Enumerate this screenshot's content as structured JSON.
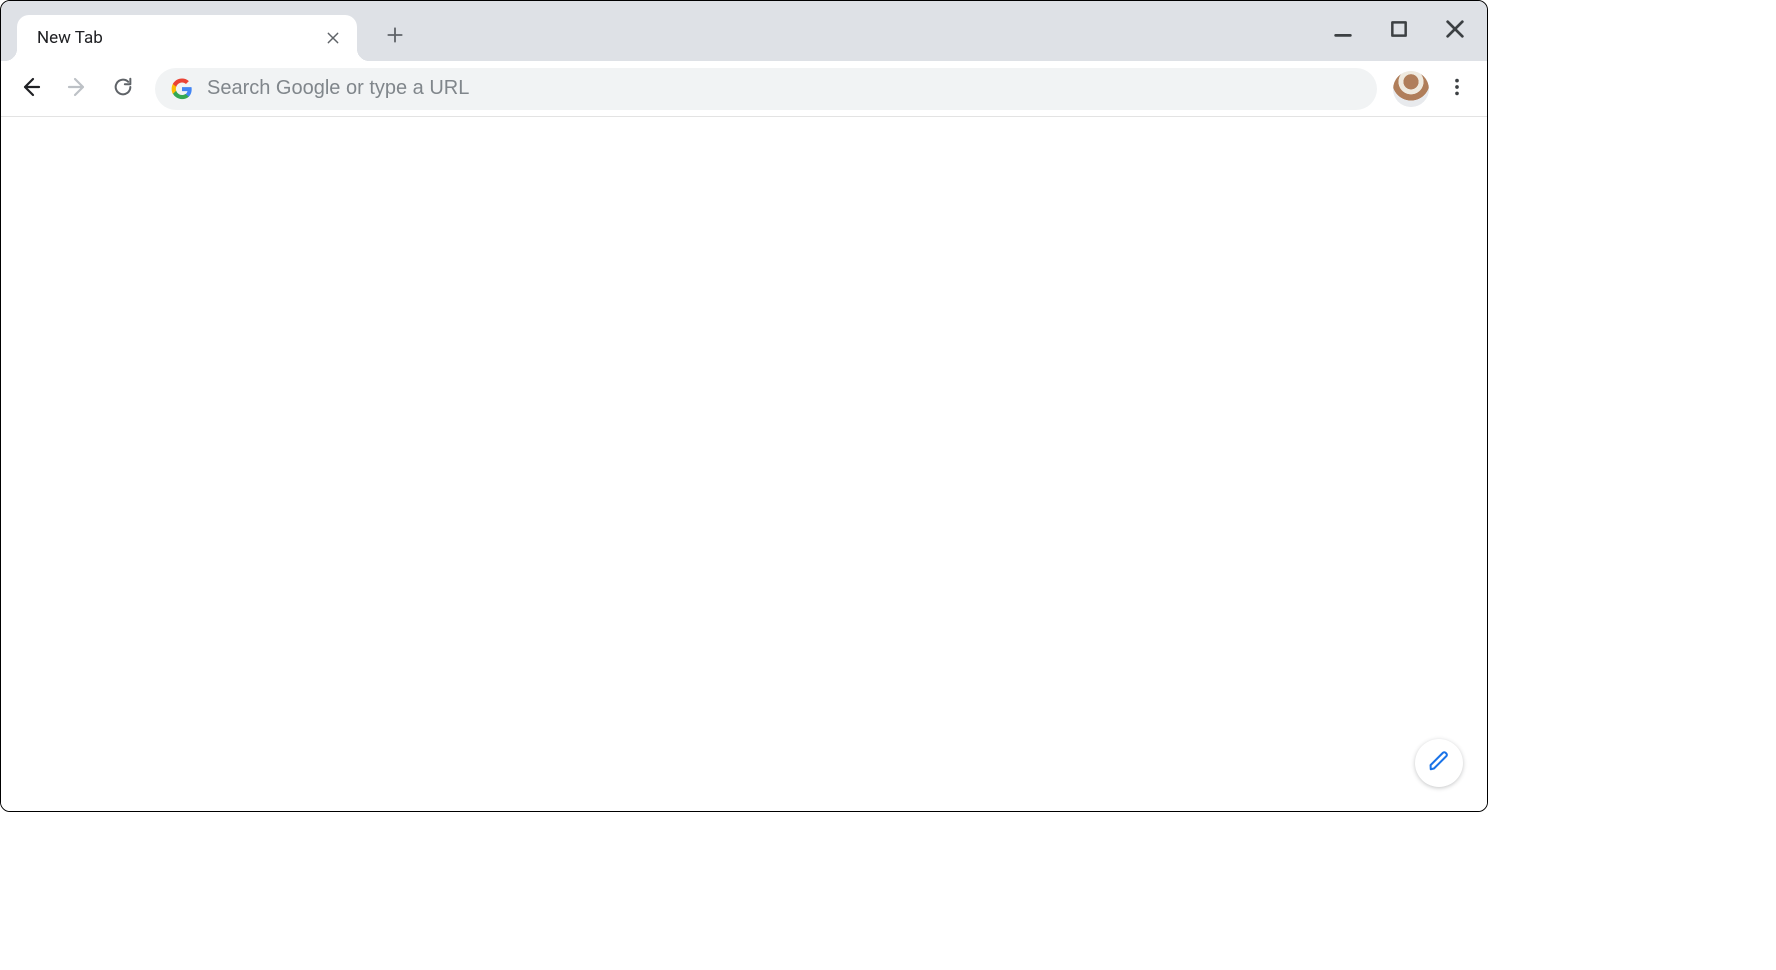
{
  "tabs": [
    {
      "title": "New Tab"
    }
  ],
  "omnibox": {
    "placeholder": "Search Google or type a URL",
    "value": ""
  },
  "icons": {
    "close": "close-icon",
    "plus": "plus-icon",
    "minimize": "minimize-icon",
    "maximize": "maximize-icon",
    "window_close": "window-close-icon",
    "back": "back-arrow-icon",
    "forward": "forward-arrow-icon",
    "reload": "reload-icon",
    "google_g": "google-g-icon",
    "profile": "profile-avatar-icon",
    "kebab": "more-vert-icon",
    "pencil": "pencil-icon"
  },
  "nav": {
    "back_enabled": true,
    "forward_enabled": false,
    "reload_enabled": true
  },
  "colors": {
    "tab_strip_bg": "#dee1e6",
    "omnibox_bg": "#f1f3f4",
    "placeholder": "#80868b",
    "accent_blue": "#1a73e8"
  }
}
